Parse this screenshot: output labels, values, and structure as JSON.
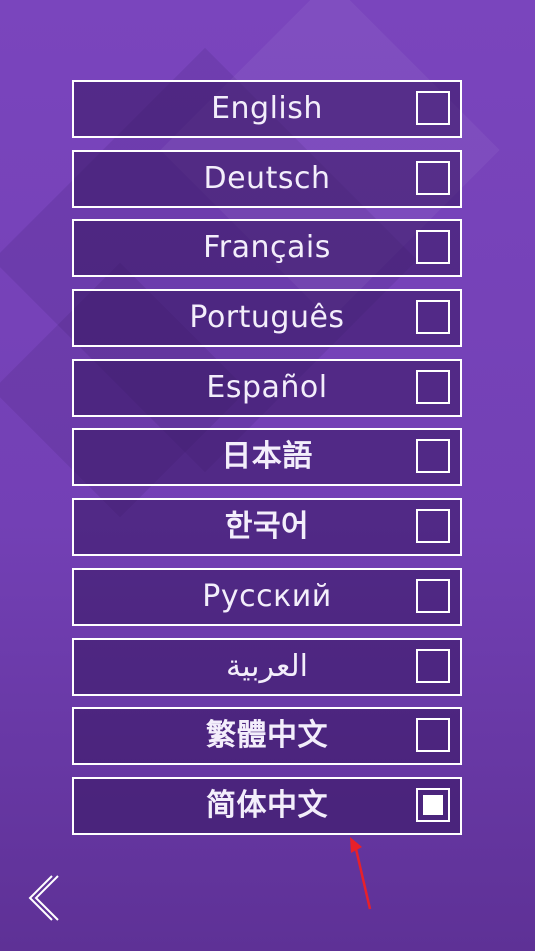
{
  "languages": [
    {
      "label": "English",
      "checked": false
    },
    {
      "label": "Deutsch",
      "checked": false
    },
    {
      "label": "Français",
      "checked": false
    },
    {
      "label": "Português",
      "checked": false
    },
    {
      "label": "Español",
      "checked": false
    },
    {
      "label": "日本語",
      "checked": false
    },
    {
      "label": "한국어",
      "checked": false
    },
    {
      "label": "Русский",
      "checked": false
    },
    {
      "label": "العربية",
      "checked": false
    },
    {
      "label": "繁體中文",
      "checked": false
    },
    {
      "label": "简体中文",
      "checked": true
    }
  ],
  "colors": {
    "background_top": "#7a45bd",
    "background_bottom": "#5e3196",
    "option_border": "#ffffff",
    "option_fill": "#3a1a6a",
    "pointer_arrow": "#e8202a"
  },
  "icons": {
    "back": "chevron-left-icon",
    "checkbox": "checkbox-icon",
    "pointer": "red-arrow-icon"
  }
}
